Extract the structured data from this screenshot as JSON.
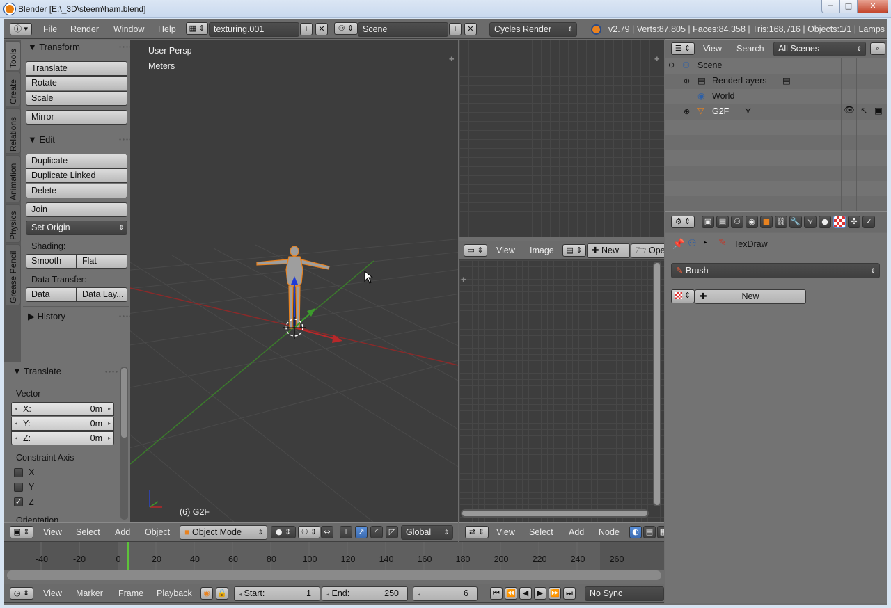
{
  "window": {
    "title": "Blender [E:\\_3D\\steem\\ham.blend]",
    "min": "─",
    "max": "□",
    "close": "✕"
  },
  "info_header": {
    "menus": [
      "File",
      "Render",
      "Window",
      "Help"
    ],
    "screen_layout": "texturing.001",
    "scene": "Scene",
    "render_engine": "Cycles Render",
    "stats": "v2.79 | Verts:87,805 | Faces:84,358 | Tris:168,716 | Objects:1/1 | Lamps"
  },
  "tool_tabs": [
    "Tools",
    "Create",
    "Relations",
    "Animation",
    "Physics",
    "Grease Pencil"
  ],
  "tools_panel": {
    "transform_header": "Transform",
    "translate": "Translate",
    "rotate": "Rotate",
    "scale": "Scale",
    "mirror": "Mirror",
    "edit_header": "Edit",
    "duplicate": "Duplicate",
    "duplicate_linked": "Duplicate Linked",
    "delete": "Delete",
    "join": "Join",
    "set_origin": "Set Origin",
    "shading_label": "Shading:",
    "smooth": "Smooth",
    "flat": "Flat",
    "data_transfer_label": "Data Transfer:",
    "data": "Data",
    "data_layout": "Data Lay...",
    "history_header": "History"
  },
  "operator_panel": {
    "header": "Translate",
    "vector_label": "Vector",
    "x": {
      "label": "X:",
      "value": "0m"
    },
    "y": {
      "label": "Y:",
      "value": "0m"
    },
    "z": {
      "label": "Z:",
      "value": "0m"
    },
    "constraint_label": "Constraint Axis",
    "cx": "X",
    "cy": "Y",
    "cz": "Z",
    "cx_checked": false,
    "cy_checked": false,
    "cz_checked": true,
    "orientation_label": "Orientation"
  },
  "viewport": {
    "persp": "User Persp",
    "units": "Meters",
    "object_info": "(6) G2F",
    "menus": [
      "View",
      "Select",
      "Add",
      "Object"
    ],
    "mode": "Object Mode",
    "orientation": "Global"
  },
  "image_editor": {
    "menus": [
      "View",
      "Image"
    ],
    "new": "New",
    "open": "Ope"
  },
  "node_editor": {
    "menus": [
      "View",
      "Select",
      "Add",
      "Node"
    ]
  },
  "outliner": {
    "menus": [
      "View",
      "Search"
    ],
    "filter": "All Scenes",
    "tree": [
      "Scene",
      "RenderLayers",
      "World",
      "G2F"
    ]
  },
  "properties": {
    "brush_name": "TexDraw",
    "brush_dropdown": "Brush",
    "new_label": "New"
  },
  "timeline": {
    "ticks": [
      "-40",
      "-20",
      "0",
      "20",
      "40",
      "60",
      "80",
      "100",
      "120",
      "140",
      "160",
      "180",
      "200",
      "220",
      "240",
      "260"
    ],
    "menus": [
      "View",
      "Marker",
      "Frame",
      "Playback"
    ],
    "start_label": "Start:",
    "start_value": "1",
    "end_label": "End:",
    "end_value": "250",
    "current_frame": "6",
    "sync": "No Sync"
  },
  "colors": {
    "accent_selected": "#e8821f",
    "x_axis": "#b8282a",
    "y_axis": "#3c9a2c",
    "z_axis": "#1f3bd6"
  }
}
